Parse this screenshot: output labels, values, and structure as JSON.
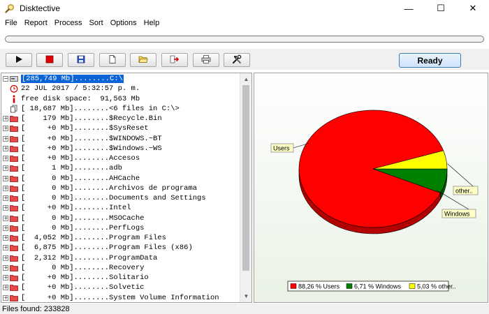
{
  "window": {
    "title": "Disktective",
    "icon": "magnifier-icon"
  },
  "window_controls": {
    "minimize": "—",
    "maximize": "☐",
    "close": "✕"
  },
  "menu": [
    "File",
    "Report",
    "Process",
    "Sort",
    "Options",
    "Help"
  ],
  "progress": {
    "value": 0
  },
  "toolbar": {
    "buttons": [
      "play-icon",
      "stop-icon",
      "save-icon",
      "new-document-icon",
      "open-folder-icon",
      "export-icon",
      "print-icon",
      "tools-icon"
    ],
    "status_button": "Ready"
  },
  "tree": {
    "root": "[285,749 Mb]........C:\\",
    "date": "22 JUL 2017 / 5:32:57 p. m.",
    "free": "free disk space:  91,563 Mb",
    "files": "[ 18,687 Mb]........<6 files in C:\\>",
    "items": [
      "[    179 Mb]........$Recycle.Bin",
      "[     +0 Mb]........$SysReset",
      "[     +0 Mb]........$WINDOWS.~BT",
      "[     +0 Mb]........$Windows.~WS",
      "[     +0 Mb]........Accesos",
      "[      1 Mb]........adb",
      "[      0 Mb]........AHCache",
      "[      0 Mb]........Archivos de programa",
      "[      0 Mb]........Documents and Settings",
      "[     +0 Mb]........Intel",
      "[      0 Mb]........MSOCache",
      "[      0 Mb]........PerfLogs",
      "[  4,052 Mb]........Program Files",
      "[  6,875 Mb]........Program Files (x86)",
      "[  2,312 Mb]........ProgramData",
      "[      0 Mb]........Recovery",
      "[     +0 Mb]........Solitario",
      "[     +0 Mb]........Solvetic",
      "[     +0 Mb]........System Volume Information"
    ]
  },
  "chart_data": {
    "type": "pie",
    "categories": [
      "Users",
      "Windows",
      "other.."
    ],
    "values": [
      88.26,
      6.71,
      5.03
    ],
    "colors": [
      "#ff0000",
      "#008000",
      "#ffff00"
    ],
    "callouts": [
      "Users",
      "Windows",
      "other.."
    ],
    "legend": [
      "88,26 % Users",
      "6,71 % Windows",
      "5,03 % other.."
    ],
    "legend_position": "bottom"
  },
  "status": {
    "text": "Files found: 233828"
  }
}
